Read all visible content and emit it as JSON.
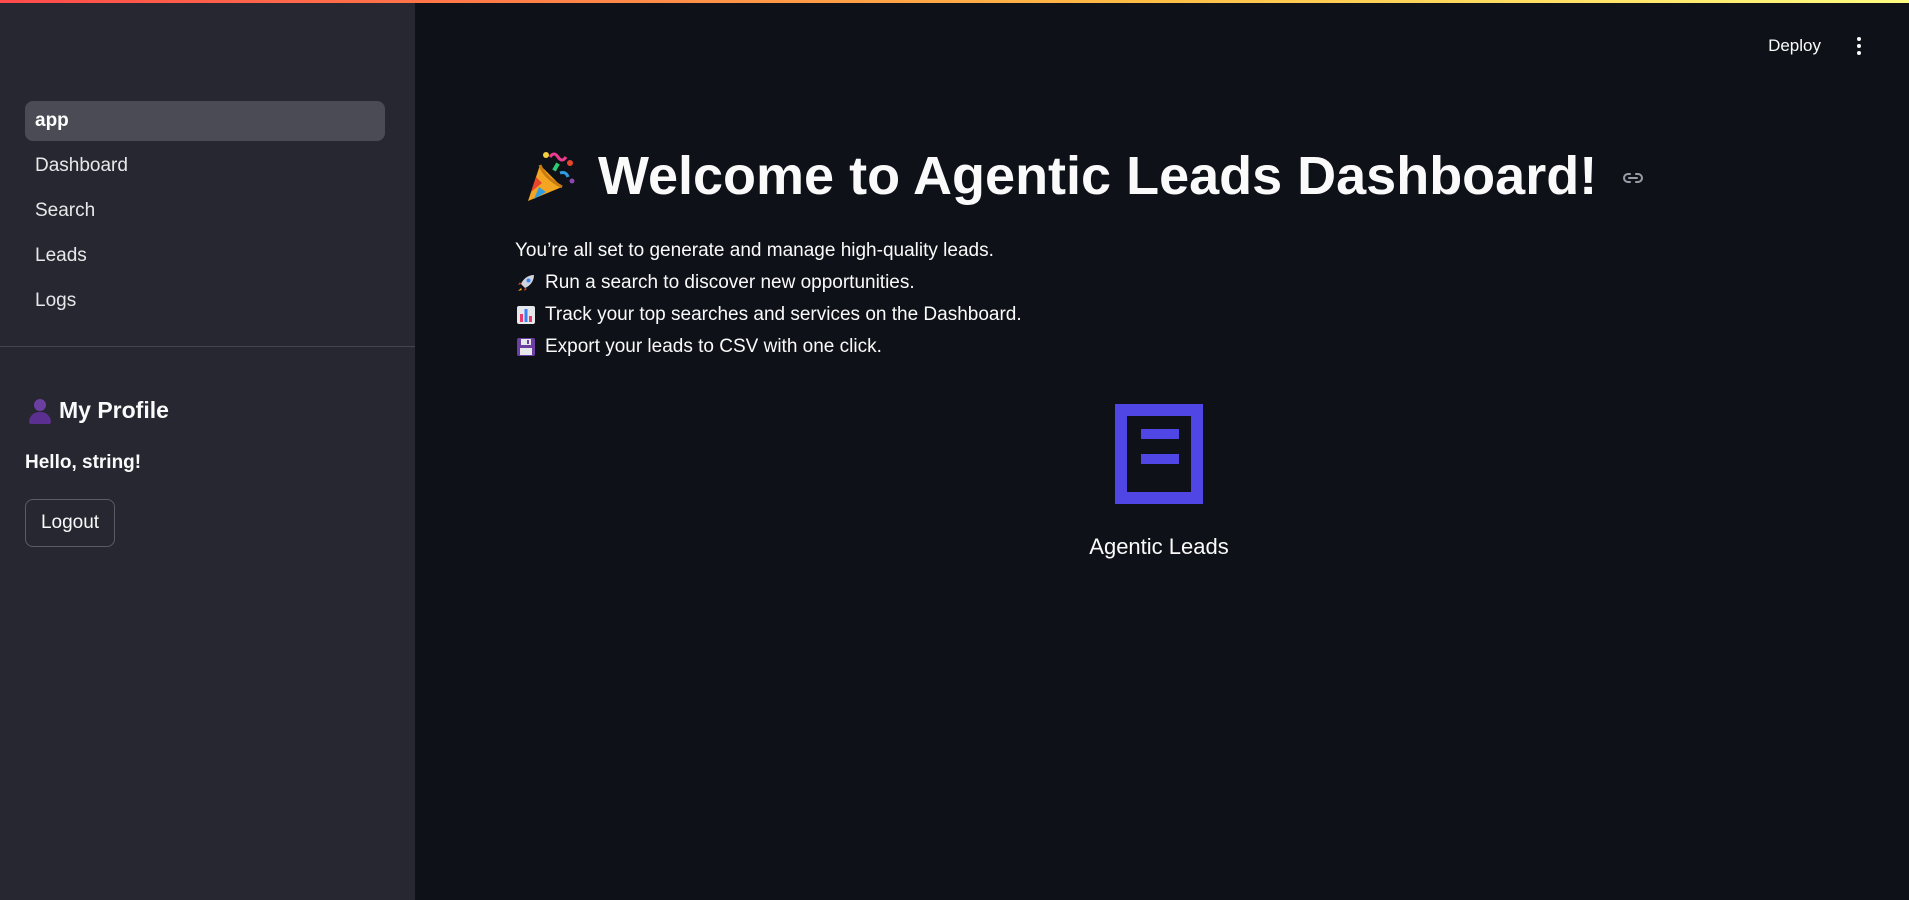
{
  "sidebar": {
    "nav": [
      {
        "label": "app",
        "active": true
      },
      {
        "label": "Dashboard",
        "active": false
      },
      {
        "label": "Search",
        "active": false
      },
      {
        "label": "Leads",
        "active": false
      },
      {
        "label": "Logs",
        "active": false
      }
    ],
    "profile": {
      "icon": "person-silhouette-icon",
      "heading": "My Profile",
      "greeting": "Hello, string!",
      "logout_label": "Logout"
    }
  },
  "header": {
    "deploy_label": "Deploy",
    "menu_icon": "kebab-menu-icon"
  },
  "main": {
    "title_icon": "party-popper-icon",
    "title": "Welcome to Agentic Leads Dashboard!",
    "intro": "You’re all set to generate and manage high-quality leads.",
    "bullets": [
      {
        "icon": "rocket-icon",
        "text": "Run a search to discover new opportunities."
      },
      {
        "icon": "bar-chart-icon",
        "text": "Track your top searches and services on the Dashboard."
      },
      {
        "icon": "floppy-disk-icon",
        "text": "Export your leads to CSV with one click."
      }
    ],
    "logo_label": "Agentic Leads"
  },
  "colors": {
    "sidebar_bg": "#262730",
    "main_bg": "#0e1117",
    "logo_accent": "#4f46e5",
    "active_nav_bg": "#4a4b55"
  }
}
